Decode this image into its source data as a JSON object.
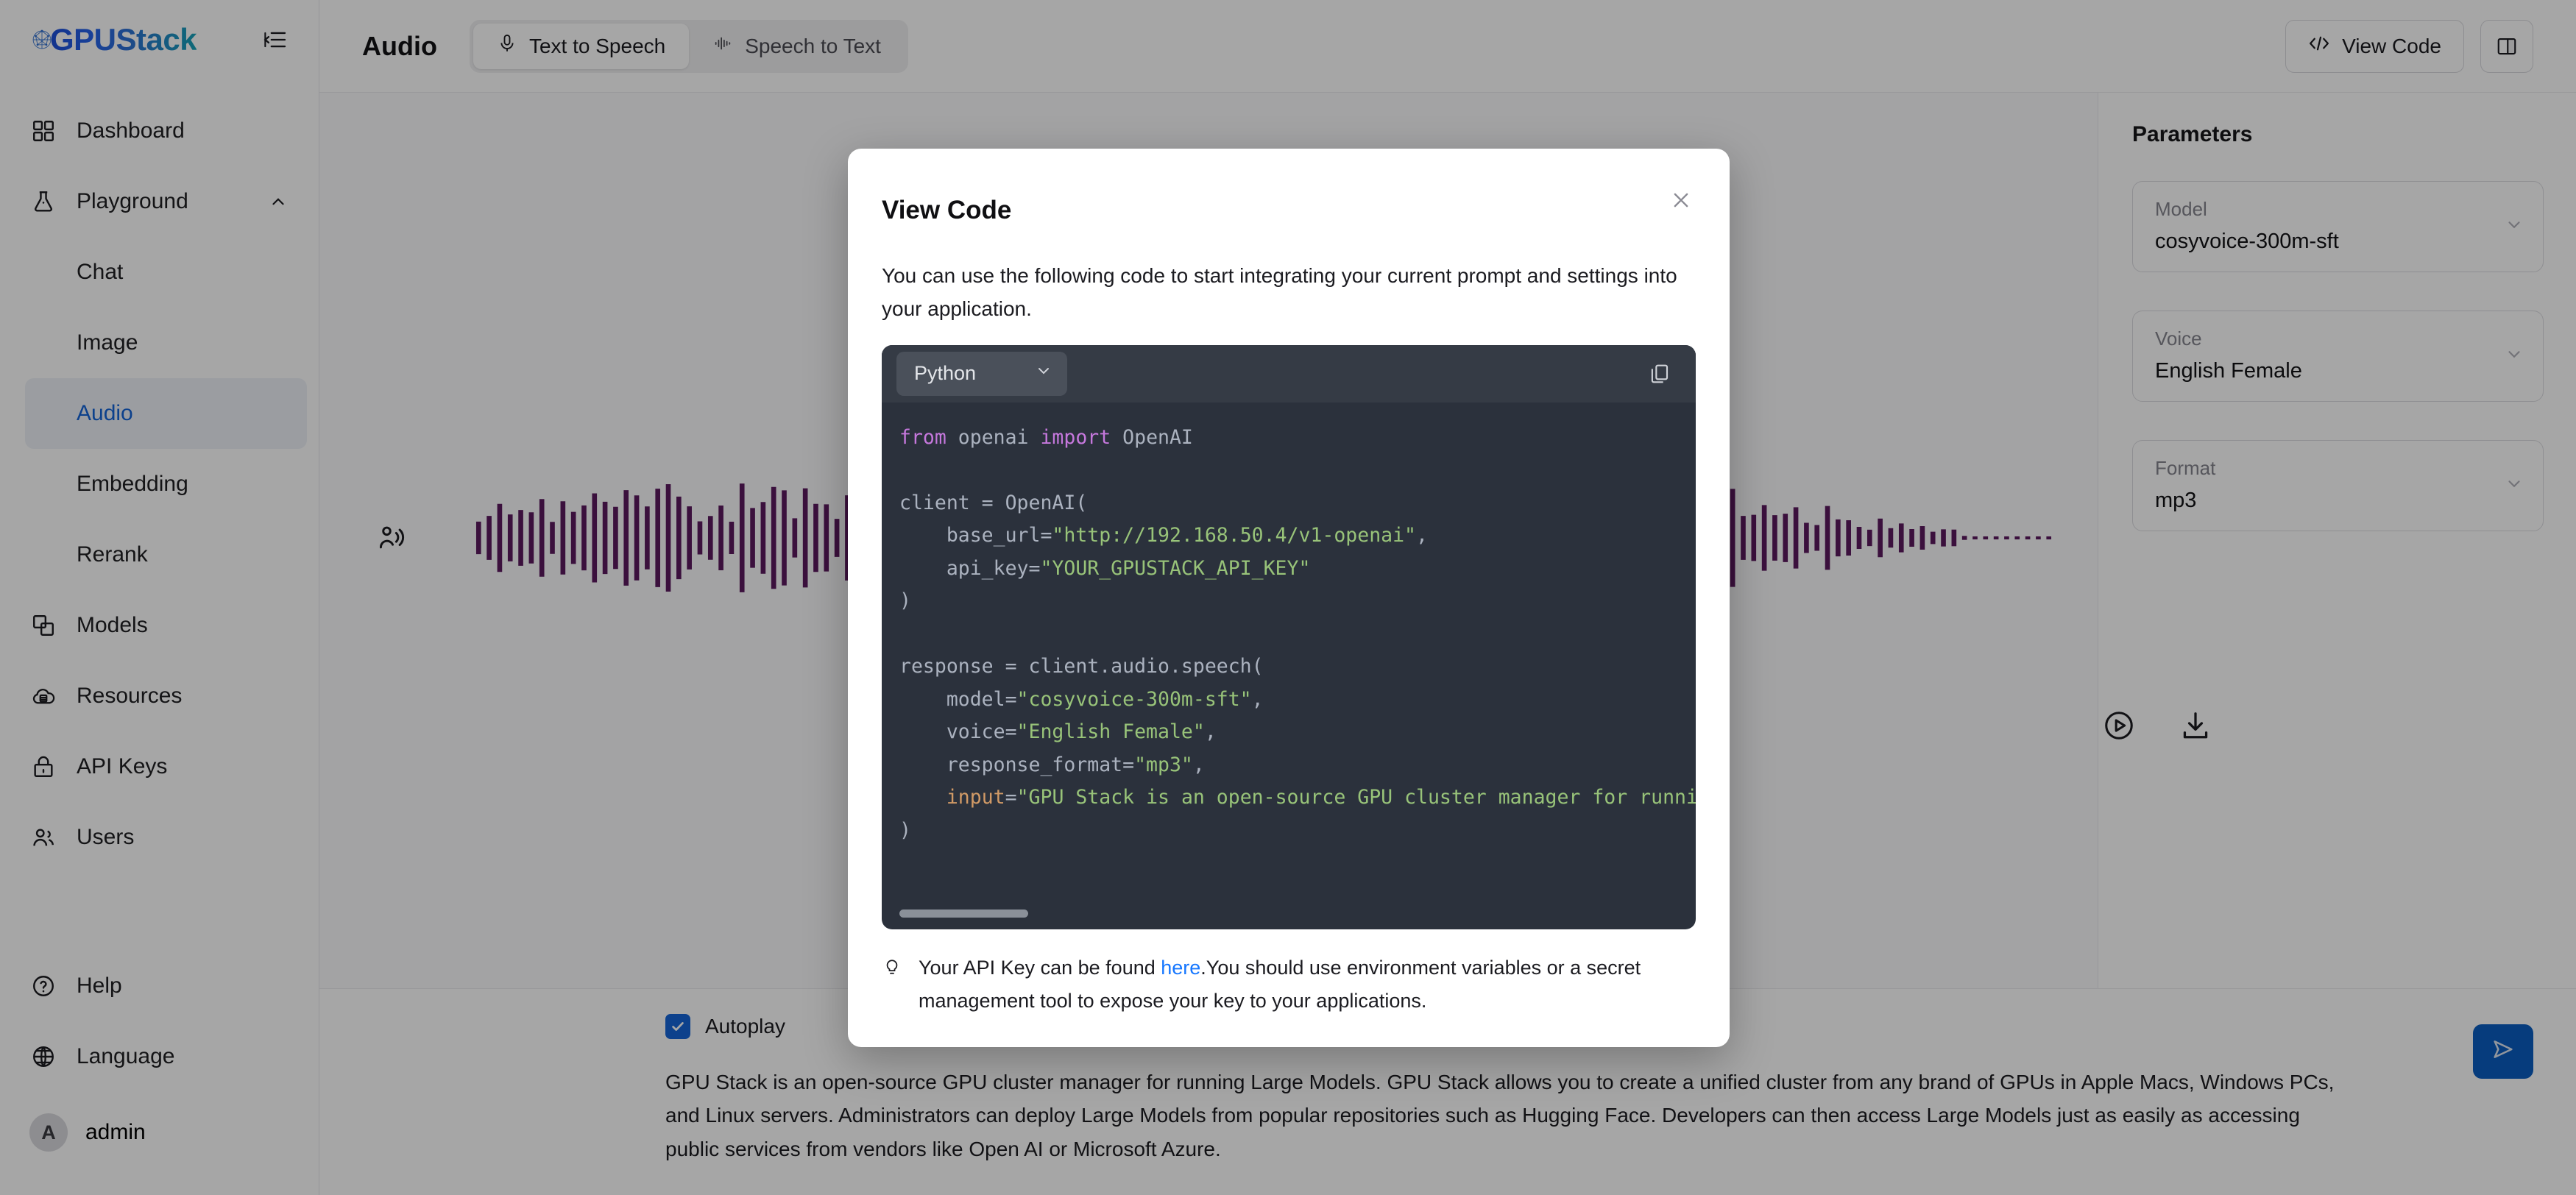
{
  "brand": {
    "name": "GPUStack"
  },
  "sidebar": {
    "collapse_icon": "collapse-sidebar-icon",
    "items": [
      {
        "label": "Dashboard",
        "icon": "grid-icon",
        "type": "top"
      },
      {
        "label": "Playground",
        "icon": "flask-icon",
        "type": "group",
        "expanded": true
      },
      {
        "label": "Chat",
        "type": "sub"
      },
      {
        "label": "Image",
        "type": "sub"
      },
      {
        "label": "Audio",
        "type": "sub",
        "active": true
      },
      {
        "label": "Embedding",
        "type": "sub"
      },
      {
        "label": "Rerank",
        "type": "sub"
      },
      {
        "label": "Models",
        "icon": "layers-icon",
        "type": "top"
      },
      {
        "label": "Resources",
        "icon": "cloud-db-icon",
        "type": "top"
      },
      {
        "label": "API Keys",
        "icon": "lock-icon",
        "type": "top"
      },
      {
        "label": "Users",
        "icon": "users-icon",
        "type": "top"
      }
    ],
    "bottom": [
      {
        "label": "Help",
        "icon": "help-circle-icon"
      },
      {
        "label": "Language",
        "icon": "globe-icon"
      }
    ],
    "user": {
      "name": "admin",
      "initial": "A"
    }
  },
  "header": {
    "title": "Audio",
    "tabs": [
      {
        "label": "Text to Speech",
        "icon": "microphone-icon",
        "active": true
      },
      {
        "label": "Speech to Text",
        "icon": "waveform-icon",
        "active": false
      }
    ],
    "view_code_label": "View Code",
    "view_code_icon": "code-brackets-icon",
    "panel_toggle_icon": "panel-layout-icon"
  },
  "player": {
    "speaker_icon": "speaker-person-icon",
    "format_label": "mp3",
    "play_icon": "play-circle-icon",
    "download_icon": "download-icon",
    "waveform_color": "#5b1a5e"
  },
  "parameters": {
    "title": "Parameters",
    "fields": [
      {
        "label": "Model",
        "value": "cosyvoice-300m-sft"
      },
      {
        "label": "Voice",
        "value": "English Female"
      },
      {
        "label": "Format",
        "value": "mp3"
      }
    ]
  },
  "composer": {
    "autoplay_label": "Autoplay",
    "autoplay_checked": true,
    "prompt_text": "GPU Stack is an open-source GPU cluster manager for running Large Models. GPU Stack allows you to create a unified cluster from any brand of GPUs in Apple Macs, Windows PCs, and Linux servers. Administrators can deploy Large Models from popular repositories such as Hugging Face. Developers can then access Large Models just as easily as accessing public services from vendors like Open AI or Microsoft Azure.",
    "send_icon": "send-icon",
    "send_button_color": "#0a5cc0"
  },
  "modal": {
    "title": "View Code",
    "close_icon": "close-icon",
    "description": "You can use the following code to start integrating your current prompt and settings into your application.",
    "language": "Python",
    "language_chevron_icon": "chevron-down-icon",
    "copy_icon": "copy-icon",
    "code_lines": [
      [
        {
          "t": "from ",
          "c": "kw"
        },
        {
          "t": "openai ",
          "c": "pl"
        },
        {
          "t": "import ",
          "c": "kw"
        },
        {
          "t": "OpenAI",
          "c": "pl"
        }
      ],
      [
        {
          "t": "",
          "c": "pl"
        }
      ],
      [
        {
          "t": "client = OpenAI(",
          "c": "pl"
        }
      ],
      [
        {
          "t": "    base_url=",
          "c": "pl"
        },
        {
          "t": "\"http://192.168.50.4/v1-openai\"",
          "c": "str"
        },
        {
          "t": ",",
          "c": "pl"
        }
      ],
      [
        {
          "t": "    api_key=",
          "c": "pl"
        },
        {
          "t": "\"YOUR_GPUSTACK_API_KEY\"",
          "c": "str"
        }
      ],
      [
        {
          "t": ")",
          "c": "pl"
        }
      ],
      [
        {
          "t": "",
          "c": "pl"
        }
      ],
      [
        {
          "t": "response = client.audio.speech(",
          "c": "pl"
        }
      ],
      [
        {
          "t": "    model=",
          "c": "pl"
        },
        {
          "t": "\"cosyvoice-300m-sft\"",
          "c": "str"
        },
        {
          "t": ",",
          "c": "pl"
        }
      ],
      [
        {
          "t": "    voice=",
          "c": "pl"
        },
        {
          "t": "\"English Female\"",
          "c": "str"
        },
        {
          "t": ",",
          "c": "pl"
        }
      ],
      [
        {
          "t": "    response_format=",
          "c": "pl"
        },
        {
          "t": "\"mp3\"",
          "c": "str"
        },
        {
          "t": ",",
          "c": "pl"
        }
      ],
      [
        {
          "t": "    ",
          "c": "pl"
        },
        {
          "t": "input",
          "c": "arg"
        },
        {
          "t": "=",
          "c": "pl"
        },
        {
          "t": "\"GPU Stack is an open-source GPU cluster manager for running Larg",
          "c": "str"
        }
      ],
      [
        {
          "t": ")",
          "c": "pl"
        }
      ]
    ],
    "footer": {
      "icon": "lightbulb-icon",
      "prefix": "Your API Key can be found ",
      "link": "here",
      "suffix": ".You should use environment variables or a secret management tool to expose your key to your applications."
    }
  }
}
